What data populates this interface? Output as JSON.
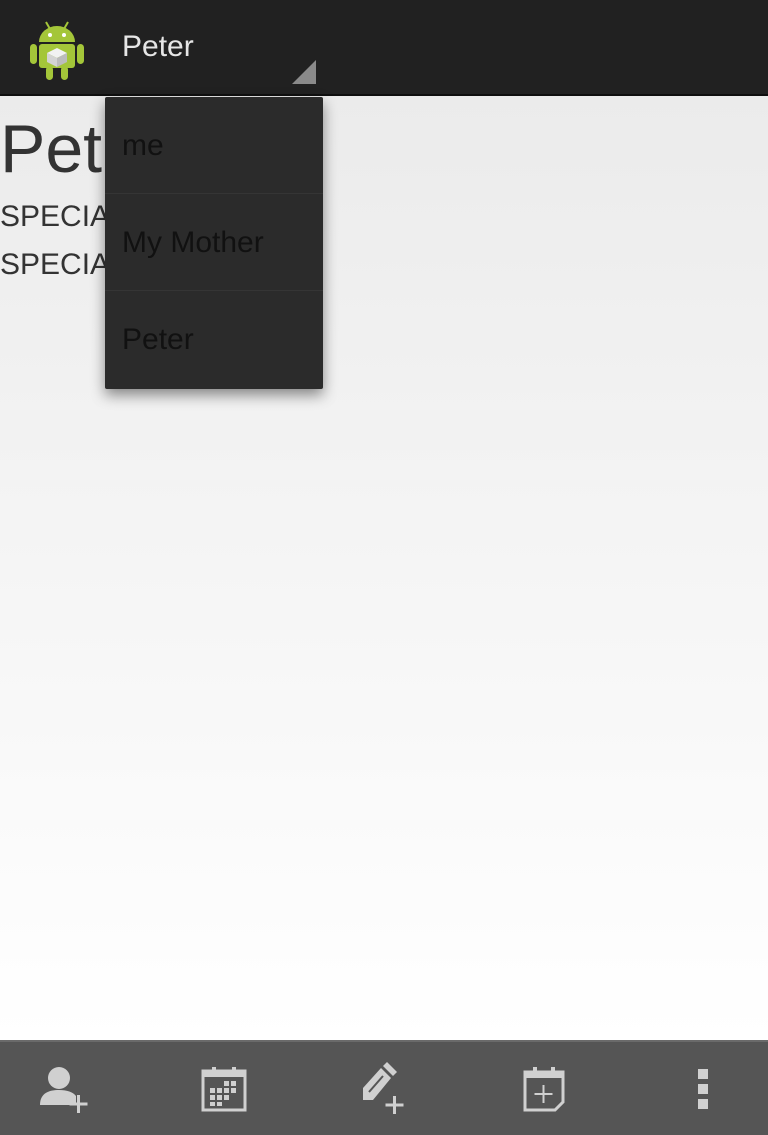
{
  "action_bar": {
    "app_icon": "android-robot-icon",
    "spinner_selected": "Peter"
  },
  "content": {
    "profile_name": "Peter",
    "lines": [
      "SPECIAL",
      "SPECIAL"
    ]
  },
  "dropdown": {
    "items": [
      "me",
      "My Mother",
      "Peter"
    ]
  },
  "bottom_bar": {
    "buttons": [
      "add-person-icon",
      "calendar-icon",
      "add-edit-icon",
      "add-calendar-event-icon",
      "overflow-menu-icon"
    ]
  },
  "colors": {
    "action_bar": "#212121",
    "dropdown": "#2b2b2b",
    "bottom_bar": "#555555",
    "icon": "#d0d0d0",
    "android_green": "#a4c639"
  }
}
